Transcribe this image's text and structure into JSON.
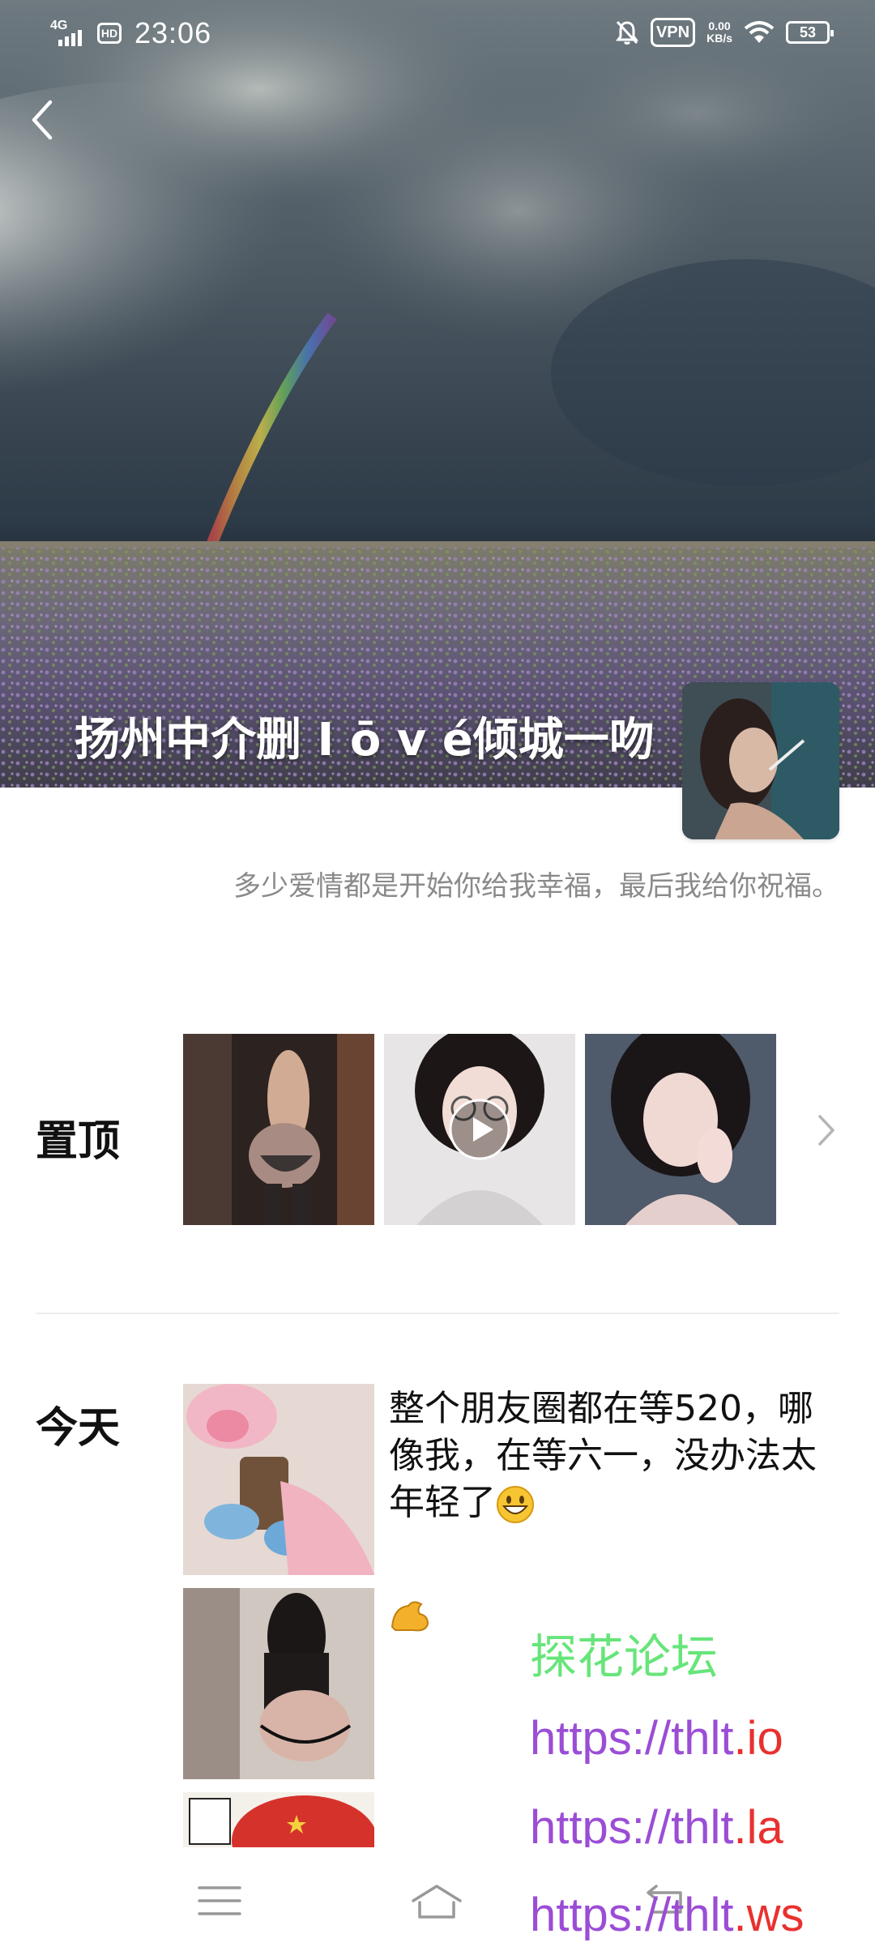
{
  "status_bar": {
    "network": "4G",
    "hd": "HD",
    "time": "23:06",
    "vpn": "VPN",
    "speed_value": "0.00",
    "speed_unit": "KB/s",
    "battery": "53"
  },
  "profile": {
    "name": "扬州中介删 I ō v é倾城一吻",
    "signature": "多少爱情都是开始你给我幸福，最后我给你祝福。"
  },
  "pinned": {
    "label": "置顶"
  },
  "today": {
    "label": "今天",
    "post1_text": "整个朋友圈都在等520，哪像我，在等六一，没办法太年轻了"
  },
  "watermark": {
    "title": "探花论坛",
    "links": [
      {
        "prefix": "https://",
        "domain": "thlt",
        "tld": ".io"
      },
      {
        "prefix": "https://",
        "domain": "thlt",
        "tld": ".la"
      },
      {
        "prefix": "https://",
        "domain": "thlt",
        "tld": ".ws"
      }
    ]
  },
  "icons": [
    "back-arrow-icon",
    "chevron-right-icon",
    "play-icon",
    "menu-icon",
    "home-icon",
    "back-nav-icon",
    "grinning-emoji-icon",
    "muscle-emoji-icon"
  ]
}
